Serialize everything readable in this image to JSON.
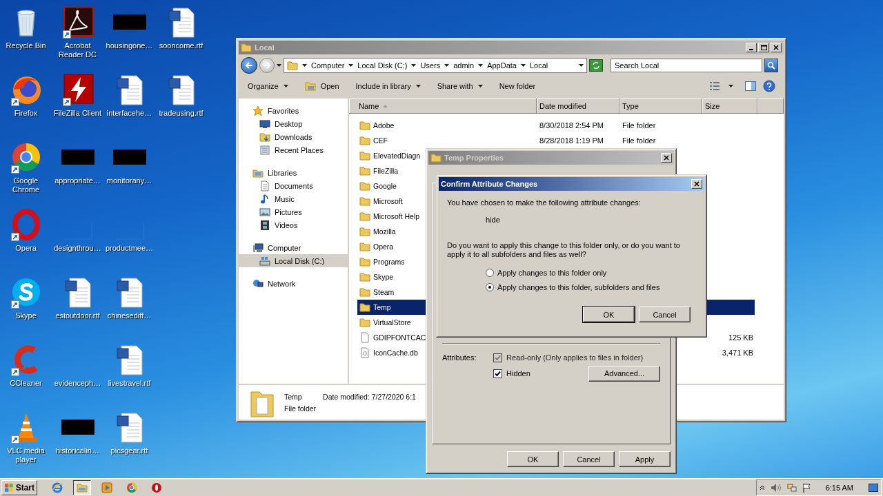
{
  "desktop": {
    "columns": [
      [
        {
          "label": "Recycle Bin",
          "kind": "recycle",
          "shortcut": false
        },
        {
          "label": "Firefox",
          "kind": "firefox",
          "shortcut": true
        },
        {
          "label": "Google Chrome",
          "kind": "chrome",
          "shortcut": true
        },
        {
          "label": "Opera",
          "kind": "opera",
          "shortcut": true
        },
        {
          "label": "Skype",
          "kind": "skype",
          "shortcut": true
        },
        {
          "label": "CCleaner",
          "kind": "ccleaner",
          "shortcut": true
        },
        {
          "label": "VLC media player",
          "kind": "vlc",
          "shortcut": true
        }
      ],
      [
        {
          "label": "Acrobat Reader DC",
          "kind": "acrobat",
          "shortcut": true
        },
        {
          "label": "FileZilla Client",
          "kind": "filezilla",
          "shortcut": true
        },
        {
          "label": "appropriate…",
          "kind": "redacted",
          "shortcut": false
        },
        {
          "label": "designthrou…",
          "kind": "blank",
          "shortcut": false
        },
        {
          "label": "estoutdoor.rtf",
          "kind": "word",
          "shortcut": false
        },
        {
          "label": "evidenceph…",
          "kind": "blank",
          "shortcut": false
        },
        {
          "label": "historicalin…",
          "kind": "redacted",
          "shortcut": false
        }
      ],
      [
        {
          "label": "housingone…",
          "kind": "redacted",
          "shortcut": false
        },
        {
          "label": "interfacehe…",
          "kind": "word",
          "shortcut": false
        },
        {
          "label": "monitorany…",
          "kind": "redacted",
          "shortcut": false
        },
        {
          "label": "productmee…",
          "kind": "blank",
          "shortcut": false
        },
        {
          "label": "chinesediff…",
          "kind": "word",
          "shortcut": false
        },
        {
          "label": "livestravel.rtf",
          "kind": "word",
          "shortcut": false
        },
        {
          "label": "picsgear.rtf",
          "kind": "word",
          "shortcut": false
        }
      ],
      [
        {
          "label": "sooncome.rtf",
          "kind": "word",
          "shortcut": false
        },
        {
          "label": "tradeusing.rtf",
          "kind": "word",
          "shortcut": false
        }
      ]
    ]
  },
  "explorer": {
    "title": "Local",
    "active": false,
    "breadcrumb": [
      "Computer",
      "Local Disk (C:)",
      "Users",
      "admin",
      "AppData",
      "Local"
    ],
    "search": {
      "placeholder": "Search Local"
    },
    "toolbar": [
      {
        "label": "Organize",
        "kind": "menu"
      },
      {
        "label": "Open",
        "kind": "open"
      },
      {
        "label": "Include in library",
        "kind": "menu"
      },
      {
        "label": "Share with",
        "kind": "menu"
      },
      {
        "label": "New folder",
        "kind": "plain"
      }
    ],
    "nav": [
      {
        "label": "Favorites",
        "kind": "star",
        "selected": false,
        "children": [
          {
            "label": "Desktop",
            "kind": "desktop",
            "selected": false
          },
          {
            "label": "Downloads",
            "kind": "downloads",
            "selected": false
          },
          {
            "label": "Recent Places",
            "kind": "recent",
            "selected": false
          }
        ]
      },
      {
        "label": "Libraries",
        "kind": "libraries",
        "selected": false,
        "children": [
          {
            "label": "Documents",
            "kind": "documents",
            "selected": false
          },
          {
            "label": "Music",
            "kind": "music",
            "selected": false
          },
          {
            "label": "Pictures",
            "kind": "pictures",
            "selected": false
          },
          {
            "label": "Videos",
            "kind": "videos",
            "selected": false
          }
        ]
      },
      {
        "label": "Computer",
        "kind": "computer",
        "selected": false,
        "children": [
          {
            "label": "Local Disk (C:)",
            "kind": "disk",
            "selected": true
          }
        ]
      },
      {
        "label": "Network",
        "kind": "network",
        "selected": false
      }
    ],
    "columns": [
      {
        "label": "Name",
        "sorted": true
      },
      {
        "label": "Date modified",
        "sorted": false
      },
      {
        "label": "Type",
        "sorted": false
      },
      {
        "label": "Size",
        "sorted": false
      }
    ],
    "rows": [
      {
        "name": "Adobe",
        "kind": "folder",
        "selected": false,
        "date_modified": "8/30/2018 2:54 PM",
        "type": "File folder"
      },
      {
        "name": "CEF",
        "kind": "folder",
        "selected": false,
        "date_modified": "8/28/2018 1:19 PM",
        "type": "File folder"
      },
      {
        "name": "ElevatedDiagn",
        "kind": "folder",
        "selected": false
      },
      {
        "name": "FileZilla",
        "kind": "folder",
        "selected": false
      },
      {
        "name": "Google",
        "kind": "folder",
        "selected": false
      },
      {
        "name": "Microsoft",
        "kind": "folder",
        "selected": false
      },
      {
        "name": "Microsoft Help",
        "kind": "folder",
        "selected": false
      },
      {
        "name": "Mozilla",
        "kind": "folder",
        "selected": false
      },
      {
        "name": "Opera",
        "kind": "folder",
        "selected": false
      },
      {
        "name": "Programs",
        "kind": "folder",
        "selected": false
      },
      {
        "name": "Skype",
        "kind": "folder",
        "selected": false
      },
      {
        "name": "Steam",
        "kind": "folder",
        "selected": false
      },
      {
        "name": "Temp",
        "kind": "folder",
        "selected": true
      },
      {
        "name": "VirtualStore",
        "kind": "folder",
        "selected": false
      },
      {
        "name": "GDIPFONTCAC",
        "kind": "file",
        "selected": false,
        "size": "125 KB"
      },
      {
        "name": "IconCache.db",
        "kind": "db",
        "selected": false,
        "size": "3,471 KB"
      }
    ],
    "details": {
      "name": "Temp",
      "date": "Date modified: 7/27/2020 6:1",
      "type": "File folder"
    }
  },
  "properties": {
    "title": "Temp Properties",
    "active": false,
    "attributes_label": "Attributes:",
    "checkboxes": [
      {
        "label": "Read-only (Only applies to files in folder)",
        "checked": true,
        "disabled": true
      },
      {
        "label": "Hidden",
        "checked": true,
        "disabled": false
      }
    ],
    "advanced_button": "Advanced...",
    "buttons": [
      "OK",
      "Cancel",
      "Apply"
    ]
  },
  "confirm": {
    "title": "Confirm Attribute Changes",
    "active": true,
    "message": "You have chosen to make the following attribute changes:",
    "change": "hide",
    "question": "Do you want to apply this change to this folder only, or do you want to apply it to all subfolders and files as well?",
    "options": [
      {
        "label": "Apply changes to this folder only",
        "selected": false
      },
      {
        "label": "Apply changes to this folder, subfolders and files",
        "selected": true
      }
    ],
    "buttons": [
      {
        "label": "OK",
        "default": true
      },
      {
        "label": "Cancel",
        "default": false
      }
    ]
  },
  "taskbar": {
    "start": "Start",
    "apps": [
      {
        "kind": "ie",
        "active": false
      },
      {
        "kind": "explorer",
        "active": true
      },
      {
        "kind": "media",
        "active": false
      },
      {
        "kind": "chrome",
        "active": false
      },
      {
        "kind": "opera",
        "active": false
      }
    ],
    "clock": "6:15 AM"
  }
}
